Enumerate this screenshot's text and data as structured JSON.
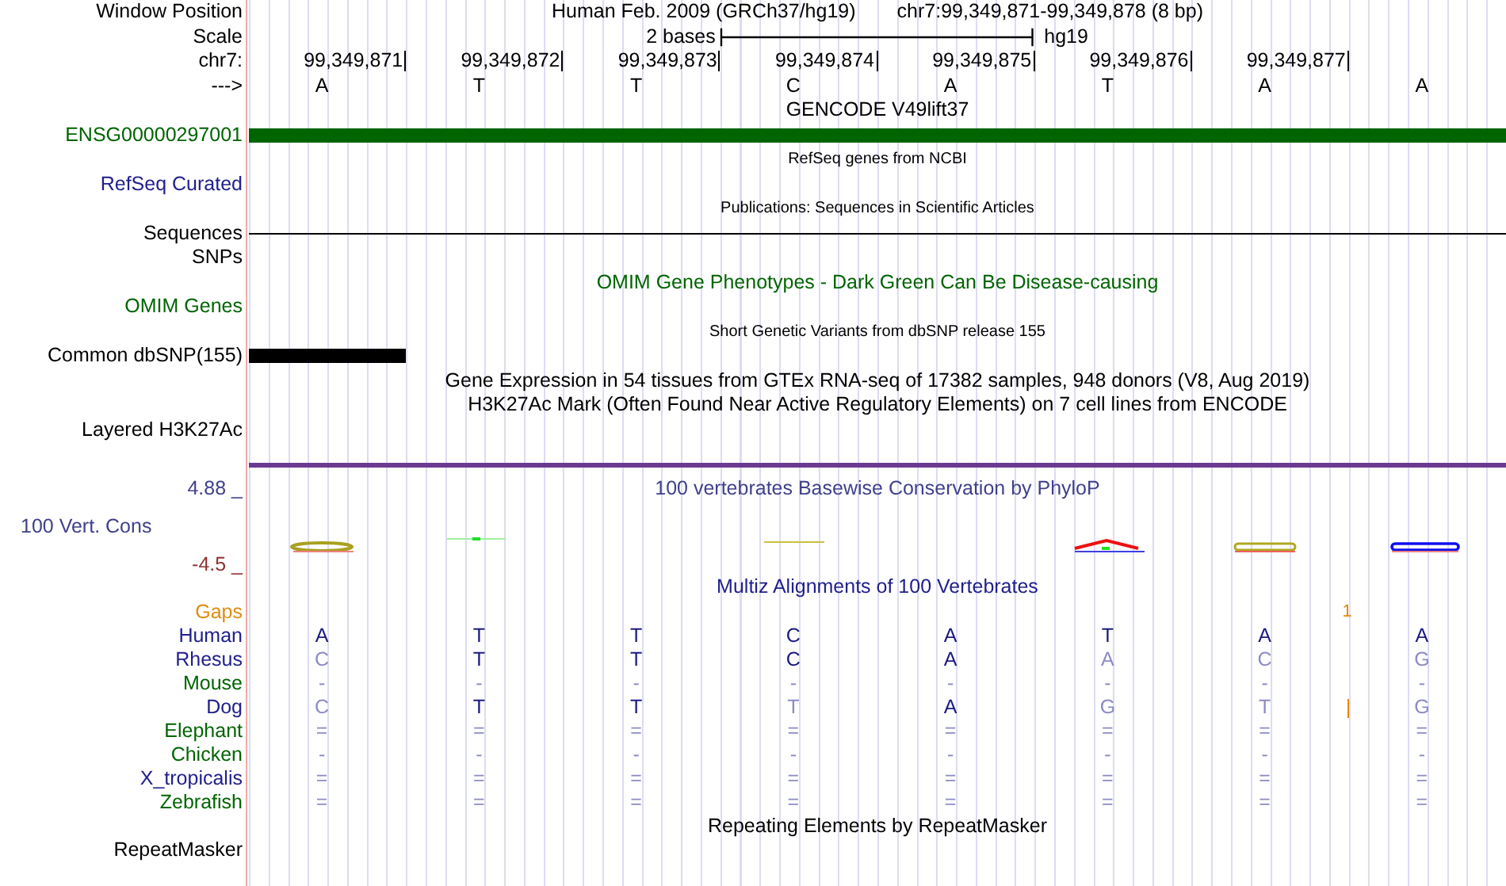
{
  "rows": [
    {
      "kind": "position",
      "label": "Window Position",
      "color": "#000000",
      "assembly": "Human Feb. 2009 (GRCh37/hg19)",
      "range": "chr7:99,349,871-99,349,878 (8 bp)"
    },
    {
      "kind": "scale",
      "label": "Scale",
      "color": "#000000",
      "span": "2 bases",
      "assembly": "hg19"
    },
    {
      "kind": "ticks",
      "label": "chr7:",
      "color": "#000000",
      "ticks": [
        "99,349,871",
        "99,349,872",
        "99,349,873",
        "99,349,874",
        "99,349,875",
        "99,349,876",
        "99,349,877"
      ]
    },
    {
      "kind": "bases",
      "label": "--->",
      "color": "#000000",
      "bases": [
        "A",
        "T",
        "T",
        "C",
        "A",
        "T",
        "A",
        "A"
      ]
    },
    {
      "kind": "title",
      "text": "GENCODE V49lift37",
      "color": "#000000"
    },
    {
      "kind": "bar",
      "label": "ENSG00000297001",
      "color": "#006400",
      "full_length": true
    },
    {
      "kind": "subtitle",
      "text": "RefSeq genes from NCBI",
      "color": "#000000"
    },
    {
      "kind": "label",
      "label": "RefSeq Curated",
      "color": "#20208c"
    },
    {
      "kind": "subtitle",
      "text": "Publications: Sequences in Scientific Articles",
      "color": "#000000"
    },
    {
      "kind": "line",
      "label": "Sequences",
      "color": "#000000"
    },
    {
      "kind": "label",
      "label": "SNPs",
      "color": "#000000"
    },
    {
      "kind": "title",
      "text": "OMIM Gene Phenotypes - Dark Green Can Be Disease-causing",
      "color": "#006400"
    },
    {
      "kind": "label",
      "label": "OMIM Genes",
      "color": "#006400"
    },
    {
      "kind": "subtitle",
      "text": "Short Genetic Variants from dbSNP release 155",
      "color": "#000000"
    },
    {
      "kind": "bar",
      "label": "Common dbSNP(155)",
      "color": "#000000",
      "full_length": false
    },
    {
      "kind": "title",
      "text": "Gene Expression in 54 tissues from GTEx RNA-seq of 17382 samples, 948 donors (V8, Aug 2019)",
      "color": "#000000"
    },
    {
      "kind": "title",
      "text": "H3K27Ac Mark (Often Found Near Active Regulatory Elements) on 7 cell lines from ENCODE",
      "color": "#000000"
    },
    {
      "kind": "label",
      "label": "Layered H3K27Ac",
      "color": "#000000"
    },
    {
      "kind": "rule",
      "color": "#6a3a90"
    },
    {
      "kind": "conservation",
      "label": "100 Vert. Cons",
      "color": "#40408c",
      "axis_max": "4.88 _",
      "axis_min": "-4.5 _",
      "text": "100 vertebrates Basewise Conservation by PhyloP"
    },
    {
      "kind": "title",
      "text": "Multiz Alignments of 100 Vertebrates",
      "color": "#20208c"
    },
    {
      "kind": "gaps",
      "label": "Gaps",
      "color": "#e08c10",
      "gap_text": "1"
    },
    {
      "kind": "species",
      "label": "Human",
      "color": "#20208c",
      "bases": [
        {
          "b": "A",
          "match": true
        },
        {
          "b": "T",
          "match": true
        },
        {
          "b": "T",
          "match": true
        },
        {
          "b": "C",
          "match": true
        },
        {
          "b": "A",
          "match": true
        },
        {
          "b": "T",
          "match": true
        },
        {
          "b": "A",
          "match": true
        },
        {
          "b": "A",
          "match": true
        }
      ]
    },
    {
      "kind": "species",
      "label": "Rhesus",
      "color": "#20208c",
      "bases": [
        {
          "b": "C",
          "match": false
        },
        {
          "b": "T",
          "match": true
        },
        {
          "b": "T",
          "match": true
        },
        {
          "b": "C",
          "match": true
        },
        {
          "b": "A",
          "match": true
        },
        {
          "b": "A",
          "match": false
        },
        {
          "b": "C",
          "match": false
        },
        {
          "b": "G",
          "match": false
        }
      ]
    },
    {
      "kind": "species",
      "label": "Mouse",
      "color": "#006400",
      "bases": [
        {
          "b": "-"
        },
        {
          "b": "-"
        },
        {
          "b": "-"
        },
        {
          "b": "-"
        },
        {
          "b": "-"
        },
        {
          "b": "-"
        },
        {
          "b": "-"
        },
        {
          "b": "-"
        }
      ]
    },
    {
      "kind": "species",
      "label": "Dog",
      "color": "#20208c",
      "gap": true,
      "bases": [
        {
          "b": "C",
          "match": false
        },
        {
          "b": "T",
          "match": true
        },
        {
          "b": "T",
          "match": true
        },
        {
          "b": "T",
          "match": false
        },
        {
          "b": "A",
          "match": true
        },
        {
          "b": "G",
          "match": false
        },
        {
          "b": "T",
          "match": false
        },
        {
          "b": "G",
          "match": false
        }
      ]
    },
    {
      "kind": "species",
      "label": "Elephant",
      "color": "#006400",
      "bases": [
        {
          "b": "="
        },
        {
          "b": "="
        },
        {
          "b": "="
        },
        {
          "b": "="
        },
        {
          "b": "="
        },
        {
          "b": "="
        },
        {
          "b": "="
        },
        {
          "b": "="
        }
      ]
    },
    {
      "kind": "species",
      "label": "Chicken",
      "color": "#006400",
      "bases": [
        {
          "b": "-"
        },
        {
          "b": "-"
        },
        {
          "b": "-"
        },
        {
          "b": "-"
        },
        {
          "b": "-"
        },
        {
          "b": "-"
        },
        {
          "b": "-"
        },
        {
          "b": "-"
        }
      ]
    },
    {
      "kind": "species",
      "label": "X_tropicalis",
      "color": "#20208c",
      "bases": [
        {
          "b": "="
        },
        {
          "b": "="
        },
        {
          "b": "="
        },
        {
          "b": "="
        },
        {
          "b": "="
        },
        {
          "b": "="
        },
        {
          "b": "="
        },
        {
          "b": "="
        }
      ]
    },
    {
      "kind": "species",
      "label": "Zebrafish",
      "color": "#006400",
      "bases": [
        {
          "b": "="
        },
        {
          "b": "="
        },
        {
          "b": "="
        },
        {
          "b": "="
        },
        {
          "b": "="
        },
        {
          "b": "="
        },
        {
          "b": "="
        },
        {
          "b": "="
        }
      ]
    },
    {
      "kind": "title",
      "text": "Repeating Elements by RepeatMasker",
      "color": "#000000"
    },
    {
      "kind": "label",
      "label": "RepeatMasker",
      "color": "#000000"
    }
  ]
}
